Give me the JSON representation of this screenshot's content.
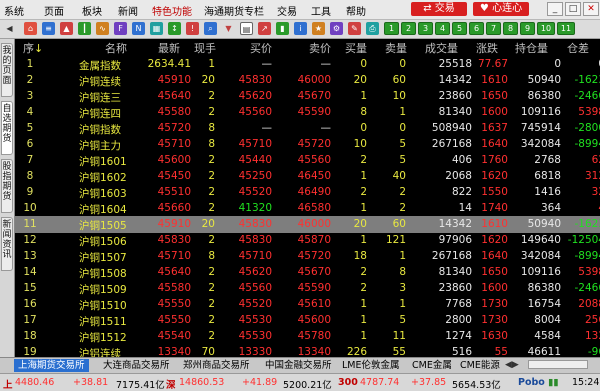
{
  "menu": {
    "items": [
      "系统",
      "页面",
      "板块",
      "新闻",
      "特色功能",
      "海通期货专栏",
      "交易",
      "工具",
      "帮助"
    ],
    "trade_label": "交易",
    "heart_label": "心连心"
  },
  "toolbar": {
    "numbers": [
      "1",
      "2",
      "3",
      "4",
      "5",
      "6",
      "7",
      "8",
      "9",
      "10",
      "11"
    ]
  },
  "sidetabs": [
    "我的页面",
    "自选期货",
    "股指期货",
    "新闻资讯"
  ],
  "columns": [
    "序",
    "名称",
    "最新",
    "现手",
    "买价",
    "卖价",
    "买量",
    "卖量",
    "成交量",
    "涨跌",
    "持仓量",
    "仓差"
  ],
  "rows": [
    {
      "seq": "1",
      "name": "金属指数",
      "last": "2634.41",
      "hand": "1",
      "bid": "—",
      "ask": "—",
      "bidv": "0",
      "askv": "0",
      "vol": "25518",
      "chg": "77.67",
      "oi": "0",
      "diff": "0"
    },
    {
      "seq": "2",
      "name": "沪铜连续",
      "last": "45910",
      "hand": "20",
      "bid": "45830",
      "ask": "46000",
      "bidv": "20",
      "askv": "60",
      "vol": "14342",
      "chg": "1610",
      "oi": "50940",
      "diff": "-1623"
    },
    {
      "seq": "3",
      "name": "沪铜连三",
      "last": "45640",
      "hand": "2",
      "bid": "45620",
      "ask": "45670",
      "bidv": "1",
      "askv": "10",
      "vol": "23860",
      "chg": "1650",
      "oi": "86380",
      "diff": "-2466"
    },
    {
      "seq": "4",
      "name": "沪铜连四",
      "last": "45580",
      "hand": "2",
      "bid": "45560",
      "ask": "45590",
      "bidv": "8",
      "askv": "1",
      "vol": "81340",
      "chg": "1600",
      "oi": "109116",
      "diff": "5398"
    },
    {
      "seq": "5",
      "name": "沪铜指数",
      "last": "45720",
      "hand": "8",
      "bid": "—",
      "ask": "—",
      "bidv": "0",
      "askv": "0",
      "vol": "508940",
      "chg": "1637",
      "oi": "745914",
      "diff": "-2800"
    },
    {
      "seq": "6",
      "name": "沪铜主力",
      "last": "45710",
      "hand": "8",
      "bid": "45710",
      "ask": "45720",
      "bidv": "10",
      "askv": "5",
      "vol": "267168",
      "chg": "1640",
      "oi": "342084",
      "diff": "-8994"
    },
    {
      "seq": "7",
      "name": "沪铜1601",
      "last": "45600",
      "hand": "2",
      "bid": "45440",
      "ask": "45560",
      "bidv": "2",
      "askv": "5",
      "vol": "406",
      "chg": "1760",
      "oi": "2768",
      "diff": "62"
    },
    {
      "seq": "8",
      "name": "沪铜1602",
      "last": "45450",
      "hand": "2",
      "bid": "45250",
      "ask": "46450",
      "bidv": "1",
      "askv": "40",
      "vol": "2068",
      "chg": "1620",
      "oi": "6818",
      "diff": "312"
    },
    {
      "seq": "9",
      "name": "沪铜1603",
      "last": "45510",
      "hand": "2",
      "bid": "45520",
      "ask": "46490",
      "bidv": "2",
      "askv": "2",
      "vol": "822",
      "chg": "1550",
      "oi": "1416",
      "diff": "32"
    },
    {
      "seq": "10",
      "name": "沪铜1604",
      "last": "45660",
      "hand": "2",
      "bid": "41320",
      "ask": "46580",
      "bidv": "1",
      "askv": "2",
      "vol": "14",
      "chg": "1740",
      "oi": "364",
      "diff": "4"
    },
    {
      "seq": "11",
      "name": "沪铜1505",
      "last": "45910",
      "hand": "20",
      "bid": "45830",
      "ask": "46000",
      "bidv": "20",
      "askv": "60",
      "vol": "14342",
      "chg": "1610",
      "oi": "50940",
      "diff": "-1623"
    },
    {
      "seq": "12",
      "name": "沪铜1506",
      "last": "45830",
      "hand": "2",
      "bid": "45830",
      "ask": "45870",
      "bidv": "1",
      "askv": "121",
      "vol": "97906",
      "chg": "1620",
      "oi": "149640",
      "diff": "-12504"
    },
    {
      "seq": "13",
      "name": "沪铜1507",
      "last": "45710",
      "hand": "8",
      "bid": "45710",
      "ask": "45720",
      "bidv": "18",
      "askv": "1",
      "vol": "267168",
      "chg": "1640",
      "oi": "342084",
      "diff": "-8994"
    },
    {
      "seq": "14",
      "name": "沪铜1508",
      "last": "45640",
      "hand": "2",
      "bid": "45620",
      "ask": "45670",
      "bidv": "2",
      "askv": "8",
      "vol": "81340",
      "chg": "1650",
      "oi": "109116",
      "diff": "5398"
    },
    {
      "seq": "15",
      "name": "沪铜1509",
      "last": "45580",
      "hand": "2",
      "bid": "45560",
      "ask": "45590",
      "bidv": "2",
      "askv": "3",
      "vol": "23860",
      "chg": "1600",
      "oi": "86380",
      "diff": "-2466"
    },
    {
      "seq": "16",
      "name": "沪铜1510",
      "last": "45550",
      "hand": "2",
      "bid": "45520",
      "ask": "45610",
      "bidv": "1",
      "askv": "1",
      "vol": "7768",
      "chg": "1730",
      "oi": "16754",
      "diff": "2088"
    },
    {
      "seq": "17",
      "name": "沪铜1511",
      "last": "45550",
      "hand": "2",
      "bid": "45530",
      "ask": "45600",
      "bidv": "1",
      "askv": "5",
      "vol": "2800",
      "chg": "1730",
      "oi": "8004",
      "diff": "256"
    },
    {
      "seq": "18",
      "name": "沪铜1512",
      "last": "45540",
      "hand": "2",
      "bid": "45530",
      "ask": "45780",
      "bidv": "1",
      "askv": "11",
      "vol": "1274",
      "chg": "1630",
      "oi": "4584",
      "diff": "132"
    },
    {
      "seq": "19",
      "name": "沪铝连续",
      "last": "13340",
      "hand": "70",
      "bid": "13330",
      "ask": "13340",
      "bidv": "226",
      "askv": "55",
      "vol": "516",
      "chg": "55",
      "oi": "46611",
      "diff": "-96"
    }
  ],
  "selected_row": "11",
  "exchanges": [
    "上海期货交易所",
    "大连商品交易所",
    "郑州商品交易所",
    "中国金融交易所",
    "LME伦敦金属",
    "CME金属",
    "CME能源"
  ],
  "tickers": [
    {
      "a": "4480.46",
      "b": "+38.81",
      "c": "7175.41亿"
    },
    {
      "a": "14860.53",
      "b": "+41.89",
      "c": "5200.21亿"
    },
    {
      "a": "4787.74",
      "b": "+37.85",
      "c": "5654.53亿"
    }
  ],
  "ticker_prefix": [
    "上",
    "深",
    "300"
  ],
  "brand": "Pobo",
  "clock": "15:24",
  "colors": {
    "up": "#ff3030",
    "down": "#20e020",
    "name": "#e8e840",
    "selected": "#7e7e7e"
  }
}
